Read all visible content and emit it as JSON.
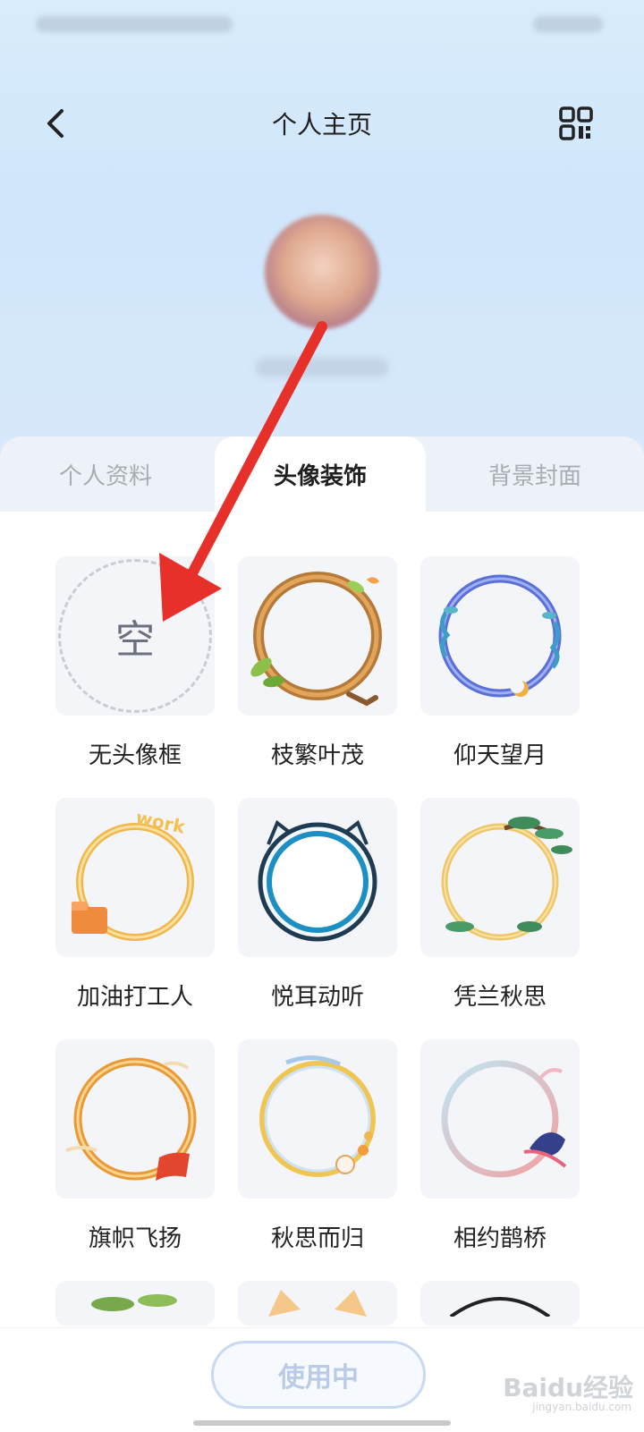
{
  "header": {
    "title": "个人主页",
    "back_icon": "chevron-left-icon",
    "qr_icon": "qr-code-icon"
  },
  "tabs": [
    {
      "label": "个人资料",
      "active": false
    },
    {
      "label": "头像装饰",
      "active": true
    },
    {
      "label": "背景封面",
      "active": false
    }
  ],
  "frames": [
    {
      "label": "无头像框",
      "empty_text": "空"
    },
    {
      "label": "枝繁叶茂"
    },
    {
      "label": "仰天望月"
    },
    {
      "label": "加油打工人",
      "badge": "work"
    },
    {
      "label": "悦耳动听"
    },
    {
      "label": "凭兰秋思"
    },
    {
      "label": "旗帜飞扬"
    },
    {
      "label": "秋思而归"
    },
    {
      "label": "相约鹊桥"
    }
  ],
  "footer": {
    "use_button": "使用中"
  },
  "watermark": {
    "text": "Baidu经验",
    "sub": "jingyan.baidu.com"
  },
  "colors": {
    "annotation_arrow": "#e8302a",
    "accent_light": "#c8daf2"
  }
}
